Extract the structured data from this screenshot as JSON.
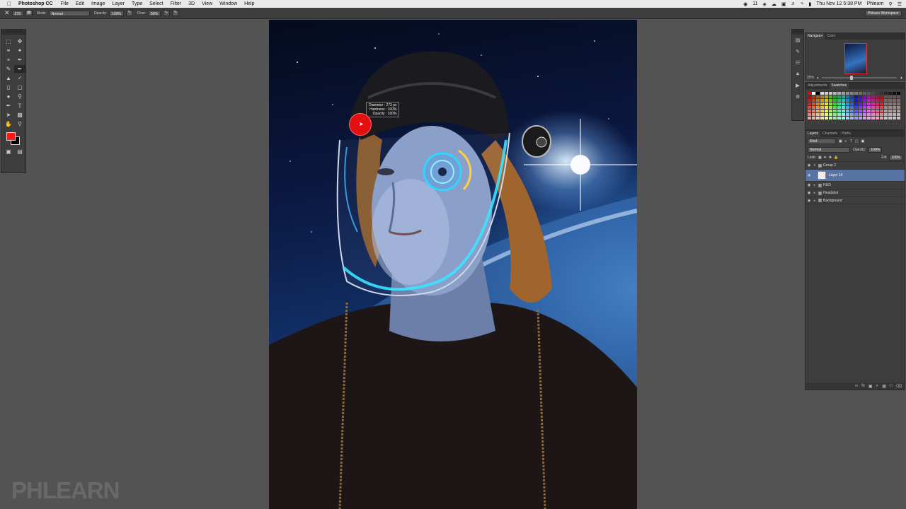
{
  "menubar": {
    "app_name": "Photoshop CC",
    "menus": [
      "File",
      "Edit",
      "Image",
      "Layer",
      "Type",
      "Select",
      "Filter",
      "3D",
      "View",
      "Window",
      "Help"
    ],
    "clock": "Thu Nov 12  5:38 PM",
    "user": "Phlearn",
    "status_count": "11"
  },
  "options": {
    "brush_size": "273",
    "mode_label": "Mode:",
    "mode_value": "Normal",
    "opacity_label": "Opacity:",
    "opacity_value": "100%",
    "flow_label": "Flow:",
    "flow_value": "50%",
    "workspace": "Phlearn Workspace"
  },
  "brush_tooltip": {
    "line1": "Diameter : 273 px",
    "line2": "Hardness :  100%",
    "line3": "Opacity :  100%"
  },
  "colors": {
    "foreground": "#ff1a1a",
    "background": "#000000"
  },
  "navigator": {
    "tabs": [
      "Navigator",
      "Color"
    ],
    "zoom": "25%"
  },
  "swatch_panel": {
    "tabs": [
      "Adjustments",
      "Swatches"
    ]
  },
  "layers_panel": {
    "tabs": [
      "Layers",
      "Channels",
      "Paths"
    ],
    "filter_kind": "Kind",
    "blend_mode": "Normal",
    "opacity_label": "Opacity:",
    "opacity_value": "100%",
    "lock_label": "Lock:",
    "fill_label": "Fill:",
    "fill_value": "100%",
    "layers": [
      {
        "name": "Group 2",
        "type": "group",
        "open": true
      },
      {
        "name": "Layer 14",
        "type": "layer",
        "selected": true
      },
      {
        "name": "HUD",
        "type": "group"
      },
      {
        "name": "Headshot",
        "type": "group"
      },
      {
        "name": "Background",
        "type": "group"
      }
    ]
  },
  "watermark": "PHLEARN"
}
